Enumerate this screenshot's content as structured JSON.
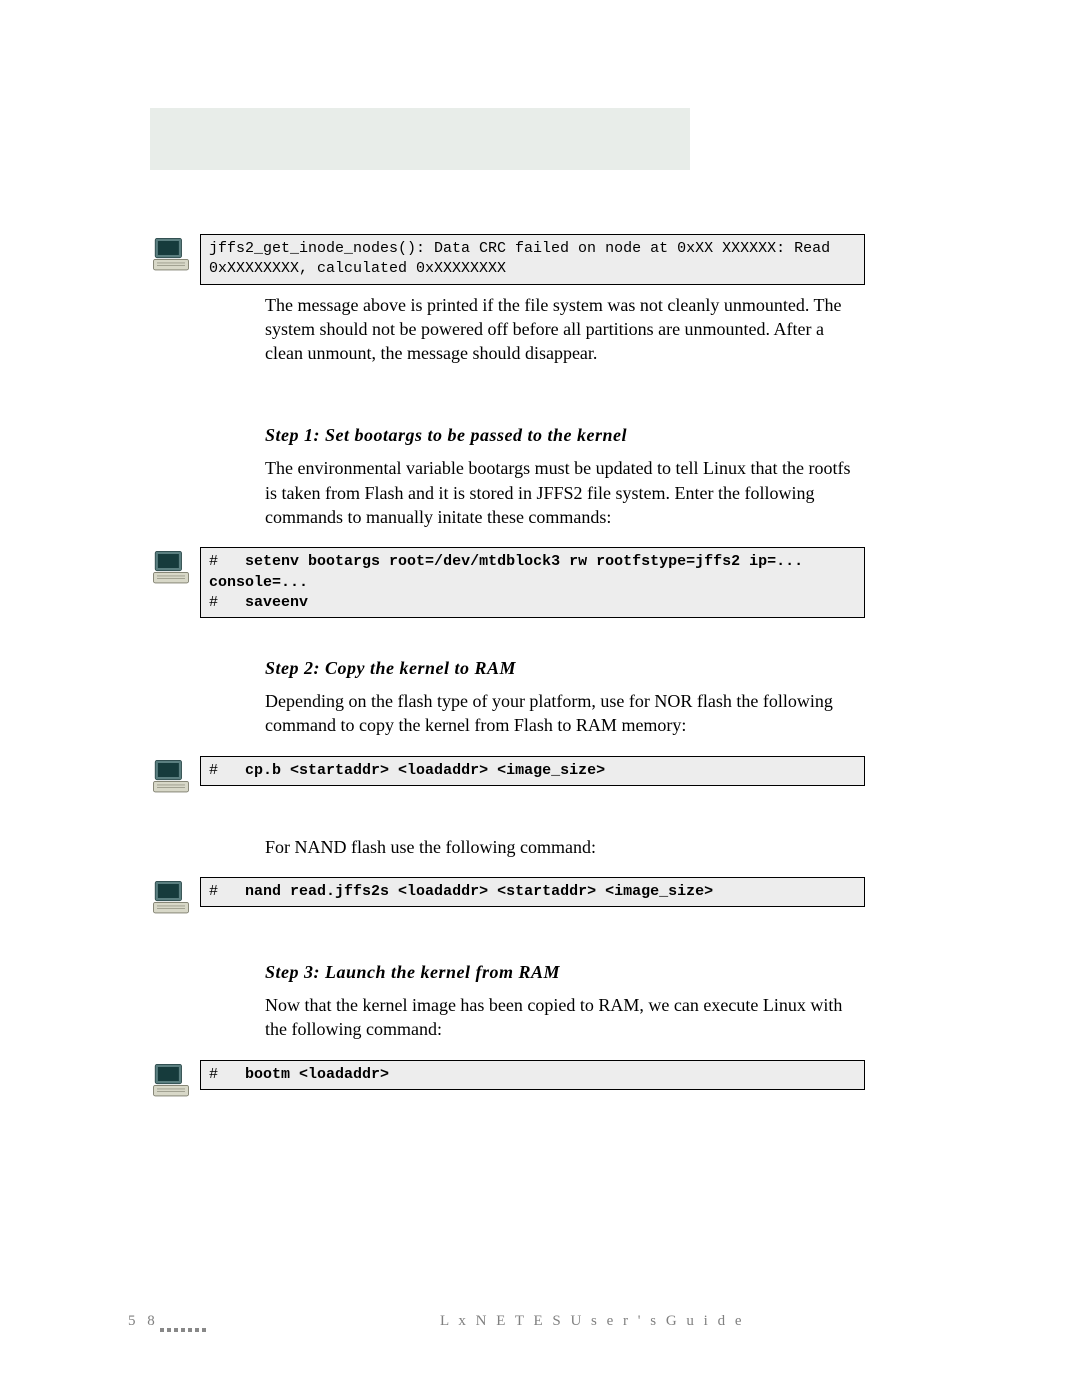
{
  "code_blocks": {
    "c1": "jffs2_get_inode_nodes(): Data CRC failed on node at 0xXX XXXXXX: Read 0xXXXXXXXX, calculated 0xXXXXXXXX",
    "c2_line1_prompt": "# ",
    "c2_line1_cmd": "setenv bootargs root=/dev/mtdblock3 rw rootfstype=jffs2 ip=... console=...",
    "c2_line2_prompt": "# ",
    "c2_line2_cmd": "saveenv",
    "c3_prompt": "# ",
    "c3_cmd": "cp.b <startaddr> <loadaddr> <image_size>",
    "c4_prompt": "# ",
    "c4_cmd": "nand read.jffs2s <loadaddr> <startaddr> <image_size>",
    "c5_prompt": "# ",
    "c5_cmd": "bootm <loadaddr>"
  },
  "paragraphs": {
    "p1": "The message above is printed if the file system was not cleanly unmounted. The system should not be powered off before all partitions are unmounted. After a clean unmount, the message should disappear.",
    "p2": "The environmental variable bootargs must be updated to tell Linux that the rootfs is taken from Flash and it is stored in JFFS2 file system. Enter the following commands to manually initate these commands:",
    "p3": "Depending on the flash type of your platform, use for NOR flash the following command to copy the kernel from Flash to RAM memory:",
    "p4": "For NAND flash use the following command:",
    "p5": "Now that the kernel image has been copied to RAM, we can execute Linux with the following command:"
  },
  "headings": {
    "h1": "Step 1: Set bootargs to be passed to the kernel",
    "h2": "Step 2: Copy the kernel to RAM",
    "h3": "Step 3: Launch the kernel from RAM"
  },
  "footer": {
    "page": "5 8",
    "title": "L x N E T E S   U s e r ' s   G u i d e"
  }
}
